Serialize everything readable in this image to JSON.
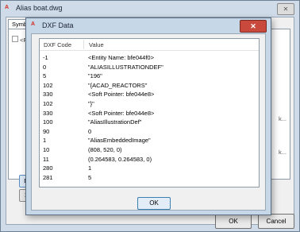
{
  "back_window": {
    "title": "Alias boat.dwg",
    "app_icon": "A",
    "tabs": [
      "Symbol T"
    ],
    "tree_root": "<R",
    "side_labels": [
      "k...",
      "k..."
    ],
    "left_buttons": [
      "D",
      "X"
    ],
    "ok_label": "OK",
    "cancel_label": "Cancel"
  },
  "dialog": {
    "title": "DXF Data",
    "app_icon": "A",
    "close_label": "✕",
    "columns": [
      "DXF Code",
      "Value"
    ],
    "rows": [
      {
        "code": "-1",
        "value": "<Entity Name: bfe044f0>"
      },
      {
        "code": "0",
        "value": "\"ALIASILLUSTRATIONDEF\""
      },
      {
        "code": "5",
        "value": "\"196\""
      },
      {
        "code": "102",
        "value": "\"{ACAD_REACTORS\""
      },
      {
        "code": "330",
        "value": "<Soft Pointer: bfe044e8>"
      },
      {
        "code": "102",
        "value": "\"}\""
      },
      {
        "code": "330",
        "value": "<Soft Pointer: bfe044e8>"
      },
      {
        "code": "100",
        "value": "\"AliasIllustrationDef\""
      },
      {
        "code": "90",
        "value": "0"
      },
      {
        "code": "1",
        "value": "\"AliasEmbeddedImage\""
      },
      {
        "code": "10",
        "value": "(808, 520, 0)"
      },
      {
        "code": "11",
        "value": "(0.264583, 0.264583, 0)"
      },
      {
        "code": "280",
        "value": "1"
      },
      {
        "code": "281",
        "value": "5"
      }
    ],
    "ok_label": "OK"
  },
  "colors": {
    "window_frame": "#cfdbe8",
    "dialog_frame": "#c6d7e8",
    "close_red": "#c94a3c",
    "default_button_border": "#3c7fb1"
  }
}
